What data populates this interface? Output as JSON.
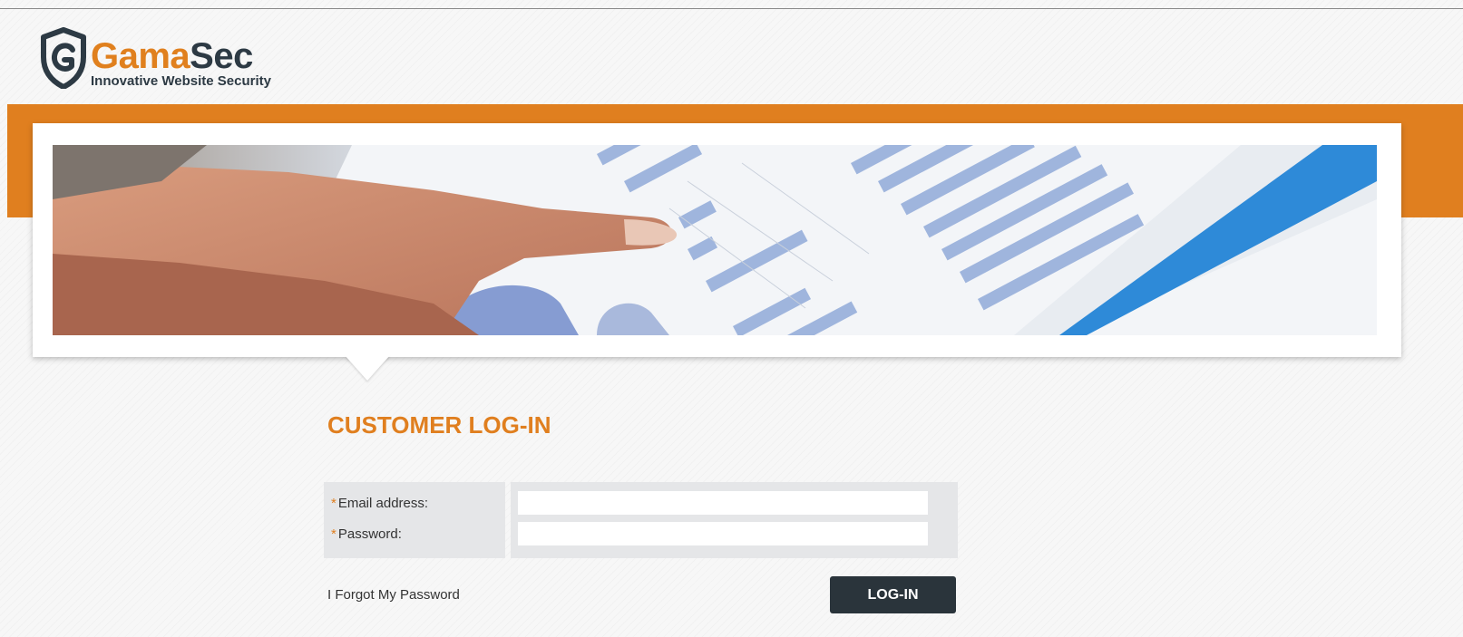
{
  "brand": {
    "name_part_1": "Gama",
    "name_part_2": "Sec",
    "tagline": "Innovative Website Security",
    "accent_color": "#e07f1f",
    "dark_color": "#2d3a44",
    "logo_icon": "shield-g-icon"
  },
  "banner": {
    "image_subject": "hand-pointing-at-tablet-charts"
  },
  "login": {
    "title": "CUSTOMER LOG-IN",
    "required_marker": "*",
    "email_label": "Email address:",
    "email_value": "",
    "password_label": "Password:",
    "password_value": "",
    "forgot_link": "I Forgot My Password",
    "submit_label": "LOG-IN"
  }
}
